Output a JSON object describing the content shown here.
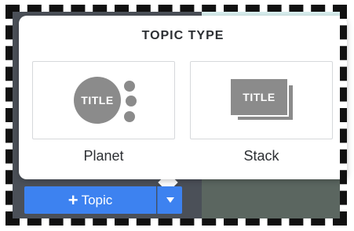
{
  "popover": {
    "title": "TOPIC TYPE",
    "options": [
      {
        "label": "Planet",
        "icon_text": "TITLE",
        "icon": "planet-icon"
      },
      {
        "label": "Stack",
        "icon_text": "TITLE",
        "icon": "stack-icon"
      }
    ]
  },
  "toolbar": {
    "add_topic_label": "Topic",
    "add_topic_icon": "plus-icon",
    "dropdown_icon": "caret-down-icon"
  },
  "colors": {
    "accent": "#3d82f0",
    "icon_gray": "#8b8b8b",
    "panel_dark": "#4b5058"
  }
}
